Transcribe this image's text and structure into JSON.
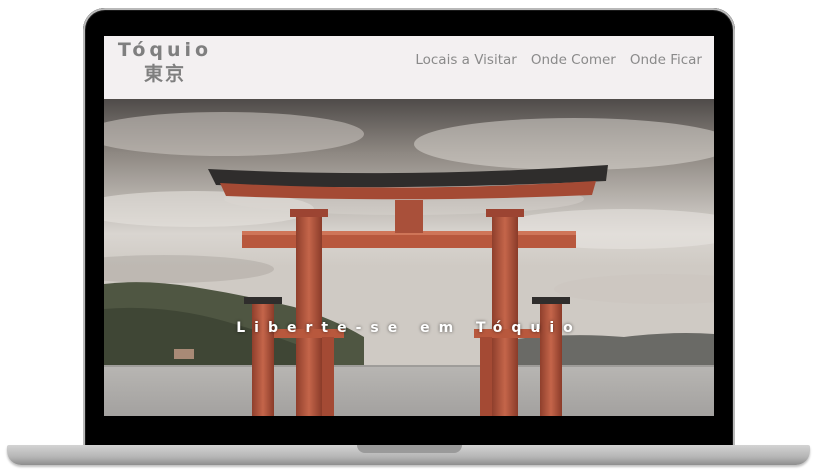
{
  "site": {
    "logo_latin": "Tóquio",
    "logo_kanji": "東京"
  },
  "nav": {
    "items": [
      {
        "label": "Locais a Visitar"
      },
      {
        "label": "Onde Comer"
      },
      {
        "label": "Onde Ficar"
      }
    ]
  },
  "hero": {
    "title": "Liberte-se em Tóquio",
    "image": "torii-gate-lake"
  },
  "colors": {
    "logo": "#7f7f7f",
    "nav": "#8a8a8a",
    "header_bg": "#f3f0f1",
    "torii": "#b5563c"
  }
}
